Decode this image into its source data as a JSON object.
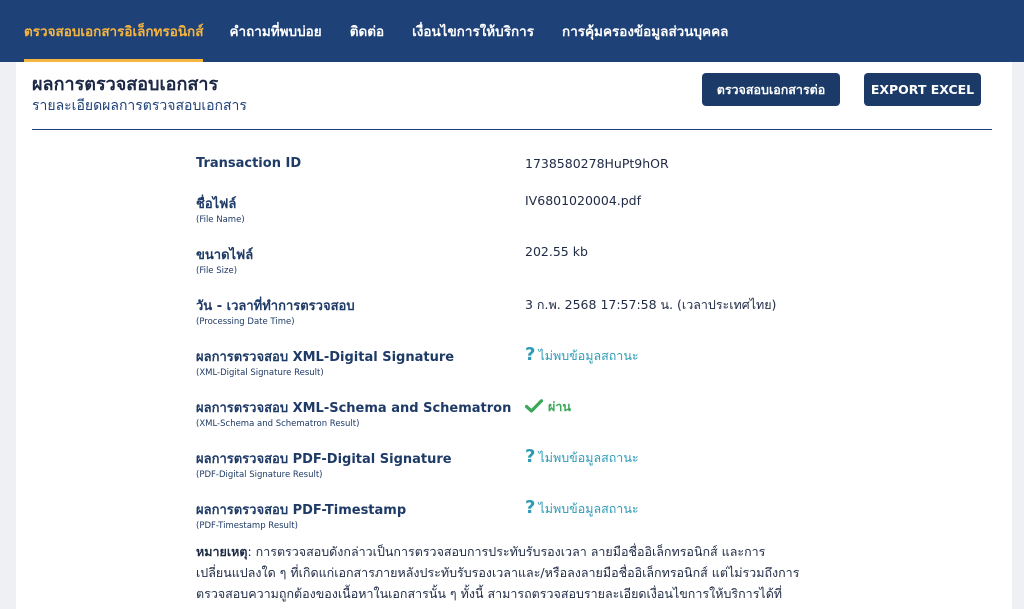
{
  "nav": {
    "items": [
      {
        "label": "ตรวจสอบเอกสารอิเล็กทรอนิกส์",
        "active": true
      },
      {
        "label": "คำถามที่พบบ่อย",
        "active": false
      },
      {
        "label": "ติดต่อ",
        "active": false
      },
      {
        "label": "เงื่อนไขการให้บริการ",
        "active": false
      },
      {
        "label": "การคุ้มครองข้อมูลส่วนบุคคล",
        "active": false
      }
    ]
  },
  "header": {
    "title": "ผลการตรวจสอบเอกสาร",
    "subtitle": "รายละเอียดผลการตรวจสอบเอกสาร",
    "verify_button": "ตรวจสอบเอกสารต่อ",
    "export_button": "EXPORT EXCEL"
  },
  "details": {
    "transaction": {
      "label": "Transaction ID",
      "value": "1738580278HuPt9hOR"
    },
    "file_name": {
      "label": "ชื่อไฟล์",
      "sublabel": "(File Name)",
      "value": "IV6801020004.pdf"
    },
    "file_size": {
      "label": "ขนาดไฟล์",
      "sublabel": "(File Size)",
      "value": "202.55 kb"
    },
    "processing_time": {
      "label": "วัน - เวลาที่ทำการตรวจสอบ",
      "sublabel": "(Processing Date Time)",
      "value": "3 ก.พ. 2568 17:57:58 น. (เวลาประเทศไทย)"
    },
    "xml_signature": {
      "label": "ผลการตรวจสอบ XML-Digital Signature",
      "sublabel": "(XML-Digital Signature Result)",
      "value": "ไม่พบข้อมูลสถานะ",
      "icon": "question-icon"
    },
    "xml_schema": {
      "label": "ผลการตรวจสอบ XML-Schema and Schematron",
      "sublabel": "(XML-Schema and Schematron Result)",
      "value": "ผ่าน",
      "icon": "check-icon"
    },
    "pdf_signature": {
      "label": "ผลการตรวจสอบ PDF-Digital Signature",
      "sublabel": "(PDF-Digital Signature Result)",
      "value": "ไม่พบข้อมูลสถานะ",
      "icon": "question-icon"
    },
    "pdf_timestamp": {
      "label": "ผลการตรวจสอบ PDF-Timestamp",
      "sublabel": "(PDF-Timestamp Result)",
      "value": "ไม่พบข้อมูลสถานะ",
      "icon": "question-icon"
    }
  },
  "note": {
    "label": "หมายเหตุ",
    "text": ": การตรวจสอบดังกล่าวเป็นการตรวจสอบการประทับรับรองเวลา ลายมือชื่ออิเล็กทรอนิกส์ และการเปลี่ยนแปลงใด ๆ ที่เกิดแก่เอกสารภายหลังประทับรับรองเวลาและ/หรือลงลายมือชื่ออิเล็กทรอนิกส์ แต่ไม่รวมถึงการตรวจสอบความถูกต้องของเนื้อหาในเอกสารนั้น ๆ ทั้งนี้ สามารถตรวจสอบรายละเอียดเงื่อนไขการให้บริการได้ที่"
  },
  "colors": {
    "nav_bg": "#1e4178",
    "nav_active": "#f6b53e",
    "button_bg": "#1b3a68",
    "unknown_status": "#2e9bb5",
    "pass_status": "#3aa857"
  }
}
